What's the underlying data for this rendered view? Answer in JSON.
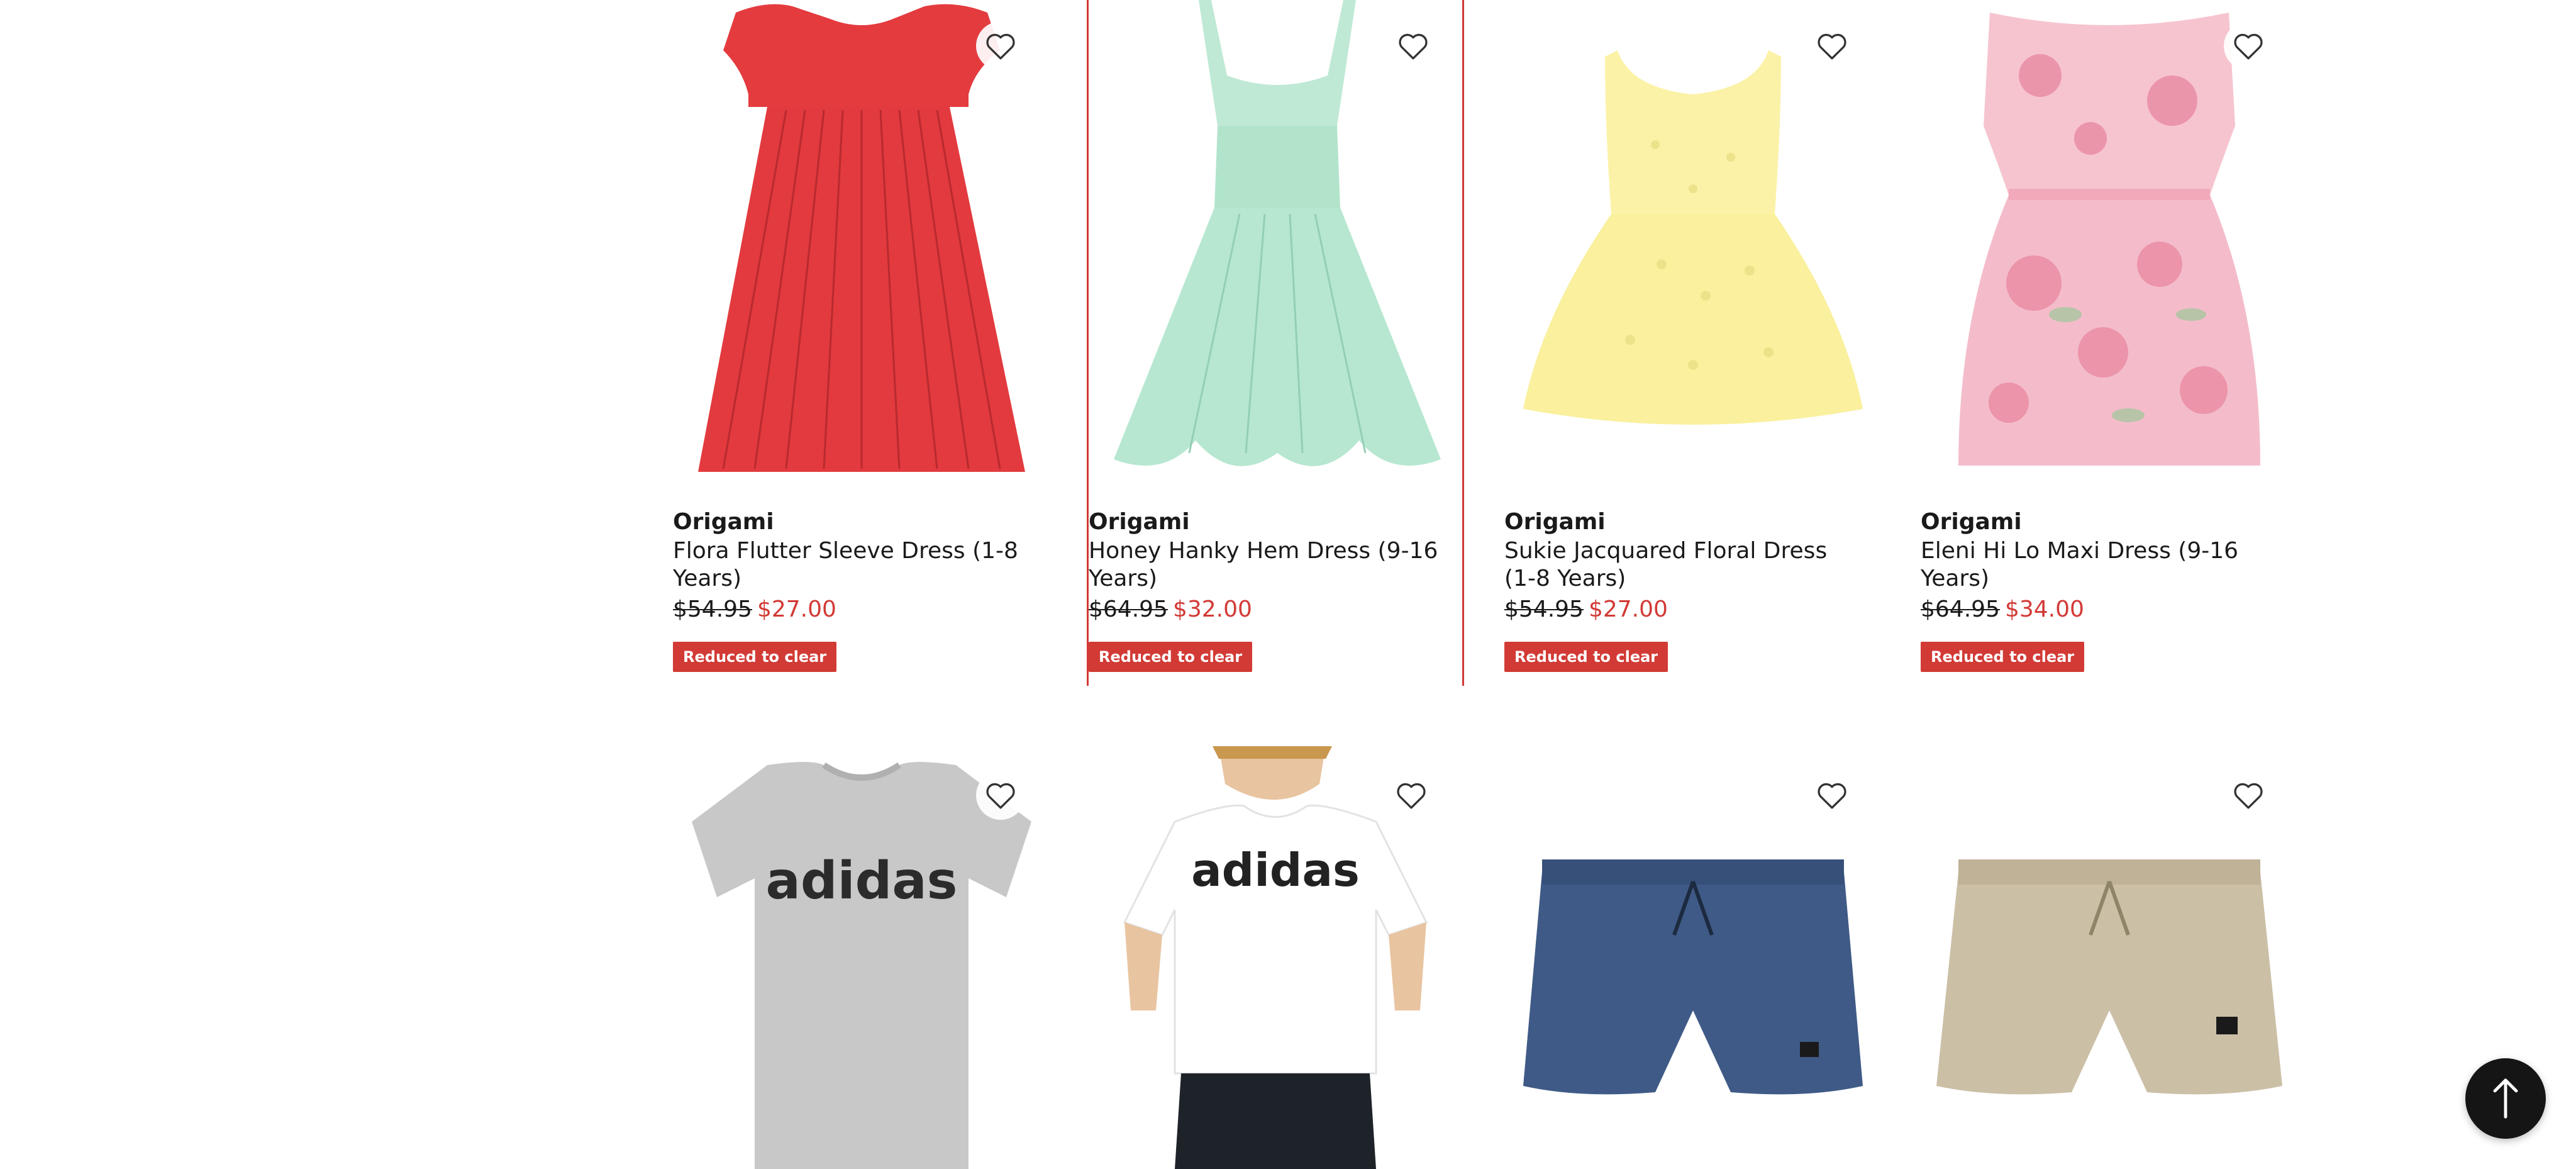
{
  "products": [
    {
      "brand": "Origami",
      "name": "Flora Flutter Sleeve Dress (1-8 Years)",
      "was": "$54.95",
      "now": "$27.00",
      "badge": "Reduced to clear",
      "image": "red pleated dress"
    },
    {
      "brand": "Origami",
      "name": "Honey Hanky Hem Dress (9-16 Years)",
      "was": "$64.95",
      "now": "$32.00",
      "badge": "Reduced to clear",
      "image": "mint green dress"
    },
    {
      "brand": "Origami",
      "name": "Sukie Jacquared Floral Dress (1-8 Years)",
      "was": "$54.95",
      "now": "$27.00",
      "badge": "Reduced to clear",
      "image": "yellow jacquard dress"
    },
    {
      "brand": "Origami",
      "name": "Eleni Hi Lo Maxi Dress (9-16 Years)",
      "was": "$64.95",
      "now": "$34.00",
      "badge": "Reduced to clear",
      "image": "pink floral maxi dress"
    }
  ],
  "row2": [
    {
      "image": "grey adidas t-shirt",
      "print": "adidas"
    },
    {
      "image": "boy in white adidas t-shirt",
      "print": "adidas"
    },
    {
      "image": "navy boardshorts"
    },
    {
      "image": "beige shorts"
    }
  ],
  "icons": {
    "wishlist": "heart-outline-icon",
    "back_to_top": "arrow-up-icon"
  },
  "colors": {
    "accent": "#d23a35",
    "text": "#1a1a1a",
    "fab": "#151515"
  }
}
